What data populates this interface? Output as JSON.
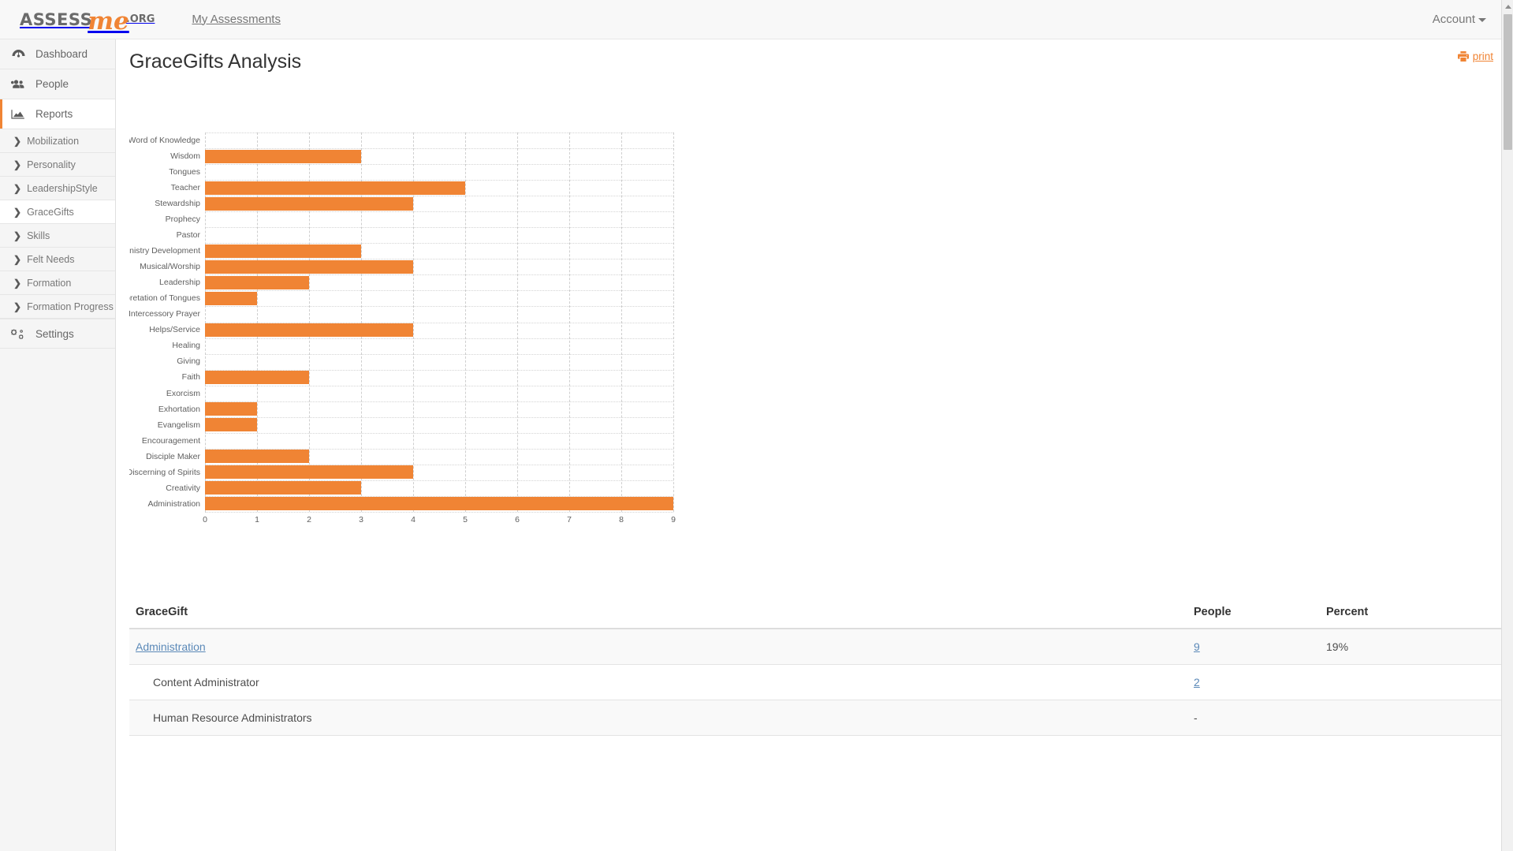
{
  "navbar": {
    "brand_assess": "ASSESS",
    "brand_me": "me",
    "brand_org": ".ORG",
    "my_assessments": "My Assessments",
    "account": "Account"
  },
  "sidebar": {
    "main_items": [
      {
        "label": "Dashboard",
        "icon": "dashboard-icon",
        "active": false
      },
      {
        "label": "People",
        "icon": "people-icon",
        "active": false
      },
      {
        "label": "Reports",
        "icon": "reports-chart-icon",
        "active": true
      }
    ],
    "report_subitems": [
      {
        "label": "Mobilization",
        "selected": false
      },
      {
        "label": "Personality",
        "selected": false
      },
      {
        "label": "LeadershipStyle",
        "selected": false
      },
      {
        "label": "GraceGifts",
        "selected": true
      },
      {
        "label": "Skills",
        "selected": false
      },
      {
        "label": "Felt Needs",
        "selected": false
      },
      {
        "label": "Formation",
        "selected": false
      },
      {
        "label": "Formation Progress",
        "selected": false
      }
    ],
    "settings": {
      "label": "Settings",
      "icon": "gears-icon"
    }
  },
  "page": {
    "title": "GraceGifts Analysis",
    "print_label": "print"
  },
  "chart_data": {
    "type": "bar",
    "orientation": "horizontal",
    "title": "",
    "xlabel": "",
    "ylabel": "",
    "xlim": [
      0,
      9
    ],
    "xticks": [
      0,
      1,
      2,
      3,
      4,
      5,
      6,
      7,
      8,
      9
    ],
    "grid": true,
    "bar_color": "#f08434",
    "categories": [
      "Word of Knowledge",
      "Wisdom",
      "Tongues",
      "Teacher",
      "Stewardship",
      "Prophecy",
      "Pastor",
      "Ministry Development",
      "Musical/Worship",
      "Leadership",
      "Interpretation of Tongues",
      "Intercessory Prayer",
      "Helps/Service",
      "Healing",
      "Giving",
      "Faith",
      "Exorcism",
      "Exhortation",
      "Evangelism",
      "Encouragement",
      "Disciple Maker",
      "Discerning of Spirits",
      "Creativity",
      "Administration"
    ],
    "values": [
      0,
      3,
      0,
      5,
      4,
      0,
      0,
      3,
      4,
      2,
      1,
      0,
      4,
      0,
      0,
      2,
      0,
      1,
      1,
      0,
      2,
      4,
      3,
      9
    ]
  },
  "table": {
    "headers": [
      "GraceGift",
      "People",
      "Percent"
    ],
    "rows": [
      {
        "name": "Administration",
        "people": "9",
        "percent": "19%",
        "link": true,
        "indent": false
      },
      {
        "name": "Content Administrator",
        "people": "2",
        "percent": "",
        "link": false,
        "indent": true
      },
      {
        "name": "Human Resource Administrators",
        "people": "-",
        "percent": "",
        "link": false,
        "indent": true
      }
    ]
  }
}
